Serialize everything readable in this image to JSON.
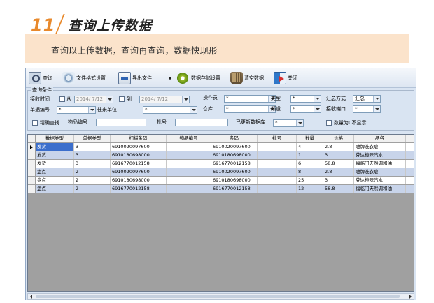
{
  "header": {
    "number": "11",
    "title": "查询上传数据"
  },
  "banner": {
    "text": "查询以上传数据，查询再查询，数据快现形"
  },
  "toolbar": {
    "query": "查询",
    "file_format": "文件格式设置",
    "export": "导出文件",
    "storage": "数据存储设置",
    "clear": "清空数据",
    "close": "关闭"
  },
  "filters": {
    "group_title": "查询条件",
    "receive_time_label": "接收时间",
    "from_label": "从",
    "from_value": "2014/ 7/12",
    "to_label": "到",
    "to_value": "2014/ 7/12",
    "operator_label": "操作员",
    "operator_value": "*",
    "type_label": "类型",
    "type_value": "*",
    "summary_label": "汇总方式",
    "summary_value": "汇总",
    "doc_no_label": "单据编号",
    "doc_no_value": "*",
    "partner_label": "往来单位",
    "partner_value": "*",
    "warehouse_label": "仓库",
    "warehouse_value": "*",
    "channel_label": "频道",
    "channel_value": "*",
    "port_label": "接收端口",
    "port_value": "*",
    "exact_label": "精确查找",
    "item_code_label": "物品编号",
    "item_code_value": "",
    "batch_label": "批号",
    "batch_value": "",
    "updated_db_label": "已更新数据库",
    "updated_db_value": "*",
    "zero_qty_label": "数量为0不显示"
  },
  "grid": {
    "columns": [
      "数据类型",
      "单据类型",
      "扫描条码",
      "物品编号",
      "条码",
      "批号",
      "数量",
      "价格",
      "品名",
      "规格"
    ],
    "rows": [
      [
        "发货",
        "3",
        "6910020097600",
        "",
        "6910020097600",
        "",
        "4",
        "2.8",
        "雕牌洗衣皂",
        ""
      ],
      [
        "发货",
        "3",
        "6910180698000",
        "",
        "6910180698000",
        "",
        "1",
        "3",
        "芬达橙味汽水",
        ""
      ],
      [
        "发货",
        "3",
        "6916770012158",
        "",
        "6916770012158",
        "",
        "6",
        "58.8",
        "福临门天然调和油",
        ""
      ],
      [
        "盘点",
        "2",
        "6910020097600",
        "",
        "6910020097600",
        "",
        "8",
        "2.8",
        "雕牌洗衣皂",
        ""
      ],
      [
        "盘点",
        "2",
        "6910180698000",
        "",
        "6910180698000",
        "",
        "25",
        "3",
        "芬达橙味汽水",
        ""
      ],
      [
        "盘点",
        "2",
        "6916770012158",
        "",
        "6916770012158",
        "",
        "12",
        "58.8",
        "福临门天然调和油",
        ""
      ]
    ],
    "row_colors": [
      "#ffffff",
      "#c8d4ea",
      "#ffffff",
      "#c8d4ea",
      "#ffffff",
      "#c8d4ea"
    ]
  },
  "colors": {
    "accent": "#e8892c",
    "banner": "#fbe3cb",
    "selected": "#3b6ecc"
  }
}
